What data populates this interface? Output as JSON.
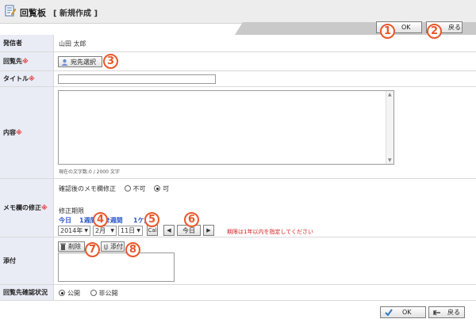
{
  "header": {
    "title": "回覧板",
    "subtitle": "[ 新規作成 ]"
  },
  "toolbar": {
    "ok_label": "OK",
    "back_label": "戻る"
  },
  "form": {
    "sender_label": "発信者",
    "sender_value": "山田 太郎",
    "recipients_label": "回覧先",
    "recipients_button": "宛先選択",
    "title_label": "タイトル",
    "title_value": "",
    "content_label": "内容",
    "content_value": "",
    "char_count": "現在の文字数:0 / 2000 文字",
    "memo_label": "メモ欄の修正",
    "memo_question": "確認後のメモ欄修正",
    "memo_option_no": "不可",
    "memo_option_yes": "可",
    "memo_selected": "可",
    "period_label": "修正期限",
    "quick_today": "今日",
    "quick_1week": "1週間",
    "quick_2weeks": "2週間",
    "quick_1month": "1ケ月",
    "year_value": "2014年",
    "month_value": "2月",
    "day_value": "11日",
    "calendar_label": "Cal",
    "today_button": "今日",
    "period_note": "期限は1年以内を指定してください",
    "attach_label": "添付",
    "attach_delete": "削除",
    "attach_add": "添付",
    "status_label": "回覧先確認状況",
    "status_option_public": "公開",
    "status_option_private": "非公開",
    "status_selected": "公開"
  },
  "callouts": [
    "1",
    "2",
    "3",
    "4",
    "5",
    "6",
    "7",
    "8"
  ],
  "colors": {
    "label_bg": "#e9ecf5",
    "required": "#e03c3c",
    "callout": "#e8572a",
    "link": "#2a56c8"
  }
}
